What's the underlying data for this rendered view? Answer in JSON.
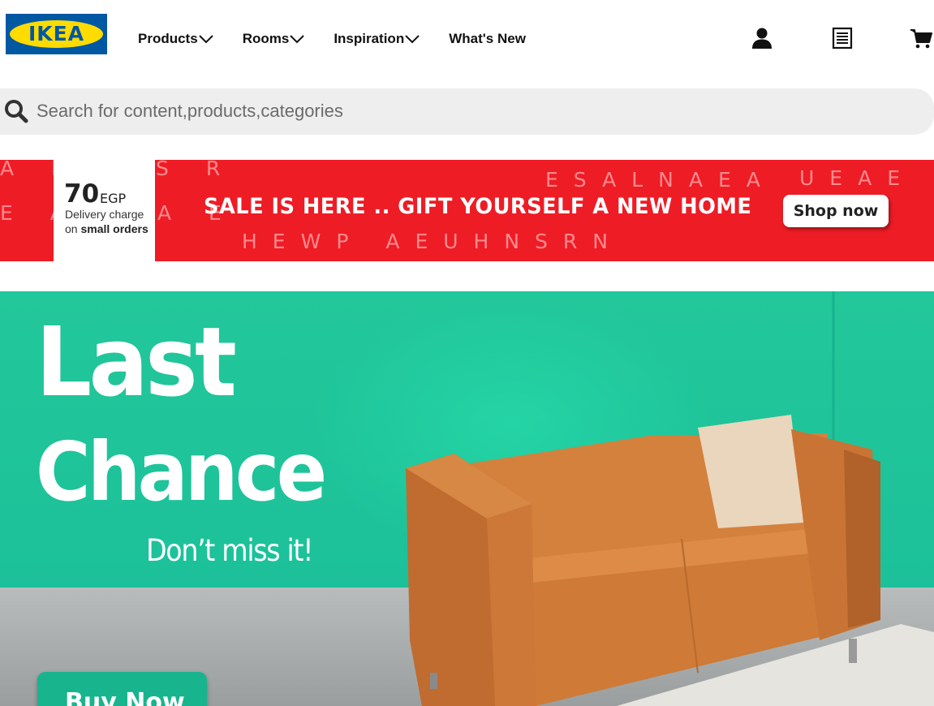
{
  "header": {
    "logo_text": "IKEA",
    "nav": [
      {
        "label": "Products",
        "has_dropdown": true
      },
      {
        "label": "Rooms",
        "has_dropdown": true
      },
      {
        "label": "Inspiration",
        "has_dropdown": true
      },
      {
        "label": "What's New",
        "has_dropdown": false
      }
    ],
    "icons": [
      "user-icon",
      "list-icon",
      "cart-icon"
    ]
  },
  "search": {
    "placeholder": "Search for content,products,categories",
    "icon": "search-icon"
  },
  "promo_banner": {
    "delivery_amount": "70",
    "delivery_currency": "EGP",
    "delivery_line1": "Delivery charge",
    "delivery_line2_prefix": "on",
    "delivery_line2_bold": "small orders",
    "headline": "SALE IS HERE .. GIFT YOURSELF A NEW HOME",
    "cta": "Shop now",
    "bg_letters": [
      "A E",
      "S R",
      "E A",
      "A E",
      "ESALNAEA",
      "UEAE",
      "HEWP AEUHNSRN"
    ],
    "color": "#ee1c25"
  },
  "hero": {
    "title_line1": "Last",
    "title_line2": "Chance",
    "subtitle": "Don’t miss it!",
    "cta": "Buy Now",
    "color": "#1fc49a"
  }
}
